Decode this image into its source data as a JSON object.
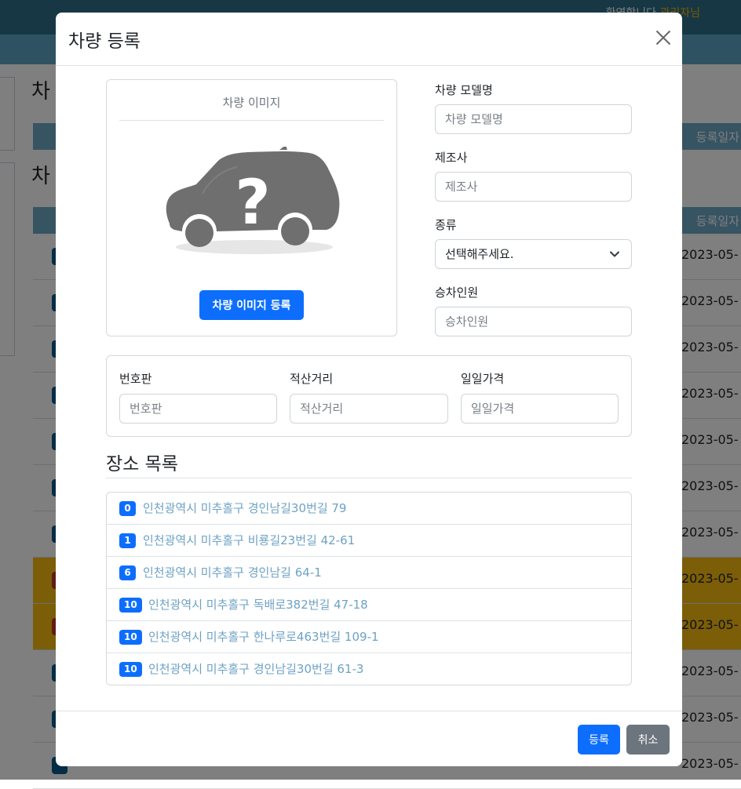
{
  "background": {
    "welcome_prefix": "환영합니다",
    "welcome_name": "관리자님",
    "page_title_1": "차",
    "page_title_2": "차",
    "column_registered_date": "등록일자",
    "row_date": "2023-05-",
    "highlight_color": "#f6bd0f"
  },
  "modal": {
    "title": "차량 등록",
    "close_icon": "close-icon",
    "image_section": {
      "title": "차량 이미지",
      "placeholder_icon": "car-question-icon",
      "upload_button": "차량 이미지 등록"
    },
    "fields": {
      "model": {
        "label": "차량 모델명",
        "placeholder": "차량 모델명"
      },
      "maker": {
        "label": "제조사",
        "placeholder": "제조사"
      },
      "type": {
        "label": "종류",
        "selected": "선택해주세요."
      },
      "seats": {
        "label": "승차인원",
        "placeholder": "승차인원"
      },
      "plate": {
        "label": "번호판",
        "placeholder": "번호판"
      },
      "mileage": {
        "label": "적산거리",
        "placeholder": "적산거리"
      },
      "daily_price": {
        "label": "일일가격",
        "placeholder": "일일가격"
      }
    },
    "places": {
      "title": "장소 목록",
      "items": [
        {
          "badge": "0",
          "address": "인천광역시 미추홀구 경인남길30번길 79"
        },
        {
          "badge": "1",
          "address": "인천광역시 미추홀구 비룡길23번길 42-61"
        },
        {
          "badge": "6",
          "address": "인천광역시 미추홀구 경인남길 64-1"
        },
        {
          "badge": "10",
          "address": "인천광역시 미추홀구 독배로382번길 47-18"
        },
        {
          "badge": "10",
          "address": "인천광역시 미추홀구 한나루로463번길 109-1"
        },
        {
          "badge": "10",
          "address": "인천광역시 미추홀구 경인남길30번길 61-3"
        }
      ]
    },
    "footer": {
      "submit": "등록",
      "cancel": "취소"
    }
  },
  "colors": {
    "primary": "#0d6efd",
    "secondary": "#6c757d",
    "link": "#6da2c4"
  }
}
